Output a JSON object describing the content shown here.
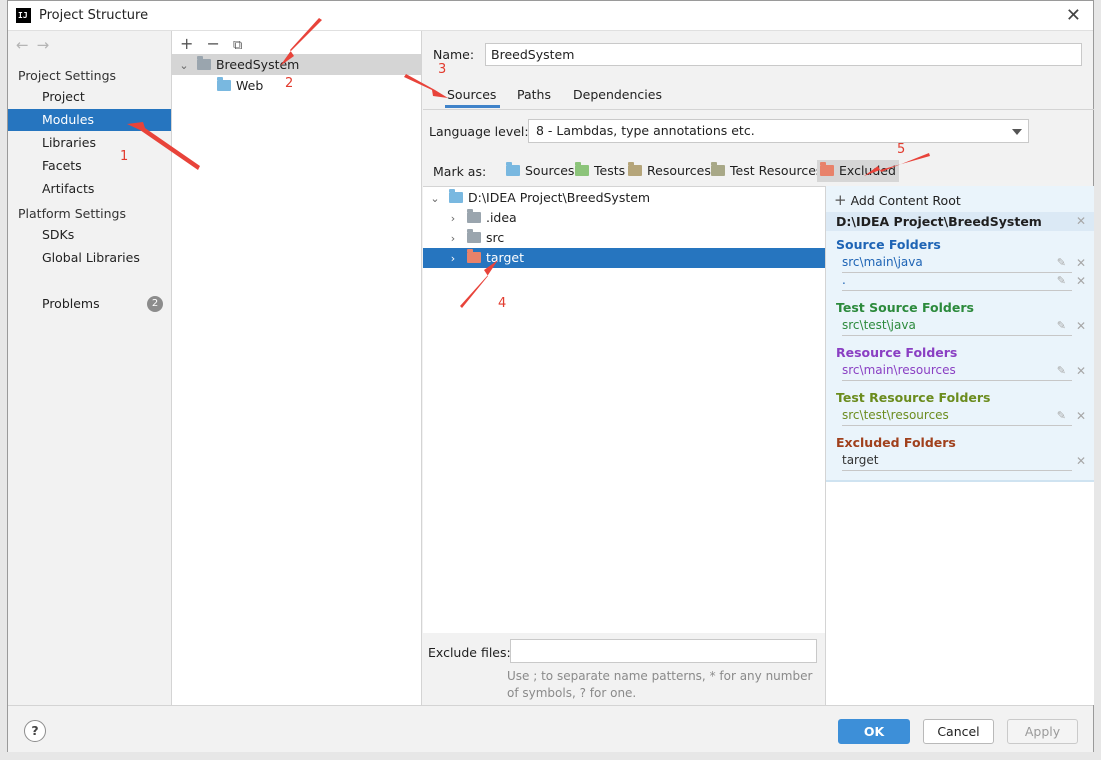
{
  "window": {
    "title": "Project Structure",
    "app_icon_text": "IJ"
  },
  "nav": {
    "back_glyph": "←",
    "forward_glyph": "→",
    "project_settings_header": "Project Settings",
    "platform_settings_header": "Platform Settings",
    "items": [
      "Project",
      "Modules",
      "Libraries",
      "Facets",
      "Artifacts"
    ],
    "platform_items": [
      "SDKs",
      "Global Libraries"
    ],
    "problems_label": "Problems",
    "problems_count": "2",
    "selected": "Modules"
  },
  "modules": {
    "toolbar": {
      "add": "+",
      "remove": "−",
      "copy": "⧉"
    },
    "root": "BreedSystem",
    "child": "Web"
  },
  "module_settings": {
    "name_label": "Name:",
    "name_value": "BreedSystem",
    "tabs": [
      "Sources",
      "Paths",
      "Dependencies"
    ],
    "active_tab": "Sources",
    "language_level_label": "Language level:",
    "language_level_value": "8 - Lambdas, type annotations etc.",
    "mark_as_label": "Mark as:",
    "mark_as_buttons": [
      "Sources",
      "Tests",
      "Resources",
      "Test Resources",
      "Excluded"
    ],
    "pressed_mark": "Excluded"
  },
  "tree": {
    "root": "D:\\IDEA Project\\BreedSystem",
    "children": [
      ".idea",
      "src",
      "target"
    ],
    "selected": "target"
  },
  "exclude": {
    "label": "Exclude files:",
    "value": "",
    "hint": "Use ; to separate name patterns, * for any number of symbols, ? for one."
  },
  "content_root": {
    "add_label": "Add Content Root",
    "path": "D:\\IDEA Project\\BreedSystem",
    "groups": [
      {
        "title": "Source Folders",
        "entries": [
          "src\\main\\java",
          "."
        ]
      },
      {
        "title": "Test Source Folders",
        "entries": [
          "src\\test\\java"
        ]
      },
      {
        "title": "Resource Folders",
        "entries": [
          "src\\main\\resources"
        ]
      },
      {
        "title": "Test Resource Folders",
        "entries": [
          "src\\test\\resources"
        ]
      },
      {
        "title": "Excluded Folders",
        "entries": [
          "target"
        ]
      }
    ]
  },
  "footer": {
    "help": "?",
    "ok": "OK",
    "cancel": "Cancel",
    "apply": "Apply"
  },
  "annotations": [
    "1",
    "2",
    "3",
    "4",
    "5"
  ],
  "colors": {
    "selection": "#2675bf",
    "sources": "#1e64b5",
    "tests": "#2c8a3c",
    "resources": "#8a3fc3",
    "test_resources": "#6b8c1e",
    "excluded": "#a0401c",
    "arrow": "#e8433a",
    "folder_blue": "#79b8e0",
    "folder_grey": "#9aa5ae",
    "folder_orange": "#e8826a"
  }
}
